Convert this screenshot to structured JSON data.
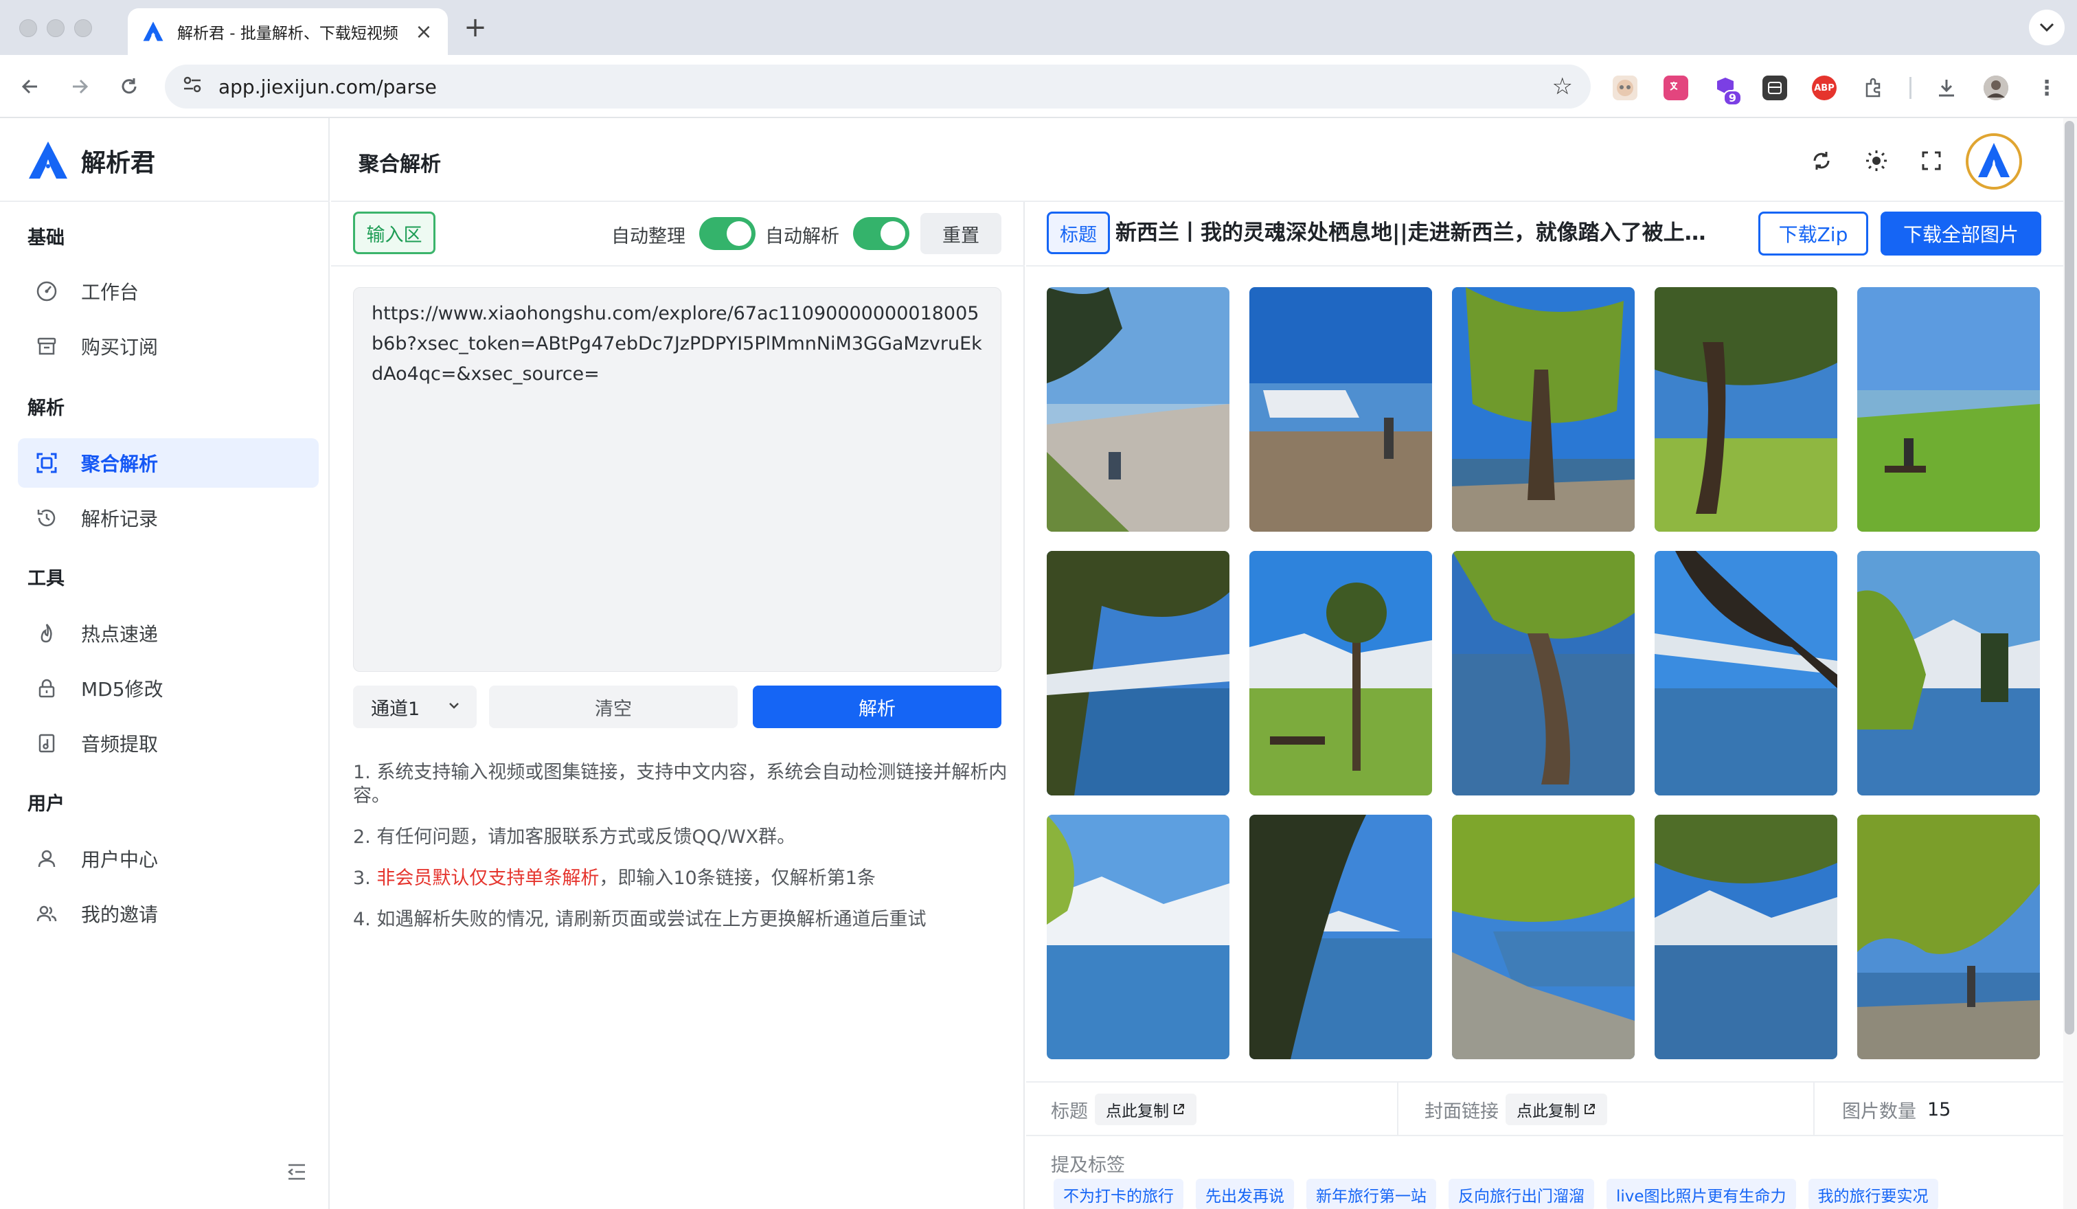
{
  "browser": {
    "tab_title": "解析君 - 批量解析、下载短视频",
    "url": "app.jiexijun.com/parse",
    "extension_badge": "9",
    "abp_label": "ABP"
  },
  "sidebar": {
    "brand": "解析君",
    "sections": {
      "basic": "基础",
      "parse": "解析",
      "tools": "工具",
      "user": "用户"
    },
    "items": {
      "workbench": "工作台",
      "subscription": "购买订阅",
      "aggregate": "聚合解析",
      "history": "解析记录",
      "hot": "热点速递",
      "md5": "MD5修改",
      "audio": "音频提取",
      "user_center": "用户中心",
      "invite": "我的邀请"
    }
  },
  "header": {
    "title": "聚合解析"
  },
  "input": {
    "area_tag": "输入区",
    "auto_organize": "自动整理",
    "auto_parse": "自动解析",
    "reset": "重置",
    "url_value": "https://www.xiaohongshu.com/explore/67ac11090000000018005b6b?xsec_token=ABtPg47ebDc7JzPDPYI5PlMmnNiM3GGaMzvruEkdAo4qc=&xsec_source=",
    "channel": "通道1",
    "clear": "清空",
    "parse": "解析",
    "notes": {
      "n1": "1. 系统支持输入视频或图集链接，支持中文内容，系统会自动检测链接并解析内容。",
      "n2": "2. 有任何问题，请加客服联系方式或反馈QQ/WX群。",
      "n3_prefix": "3. ",
      "n3_red": "非会员默认仅支持单条解析",
      "n3_suffix": "，即输入10条链接，仅解析第1条",
      "n4": "4. 如遇解析失败的情况, 请刷新页面或尝试在上方更换解析通道后重试"
    }
  },
  "result": {
    "title_tag": "标题",
    "title": "新西兰丨我的灵魂深处栖息地||走进新西兰，就像踏入了被上帝...",
    "download_zip": "下载Zip",
    "download_all": "下载全部图片",
    "info": {
      "title_label": "标题",
      "copy": "点此复制",
      "cover_label": "封面链接",
      "count_label": "图片数量",
      "count_value": "15"
    },
    "tags_label": "提及标签",
    "tags": [
      "不为打卡的旅行",
      "先出发再说",
      "新年旅行第一站",
      "反向旅行出门溜溜",
      "live图比照片更有生命力",
      "我的旅行要实况"
    ]
  },
  "colors": {
    "primary": "#1565f5",
    "green": "#34b36b",
    "red": "#e5342d"
  }
}
